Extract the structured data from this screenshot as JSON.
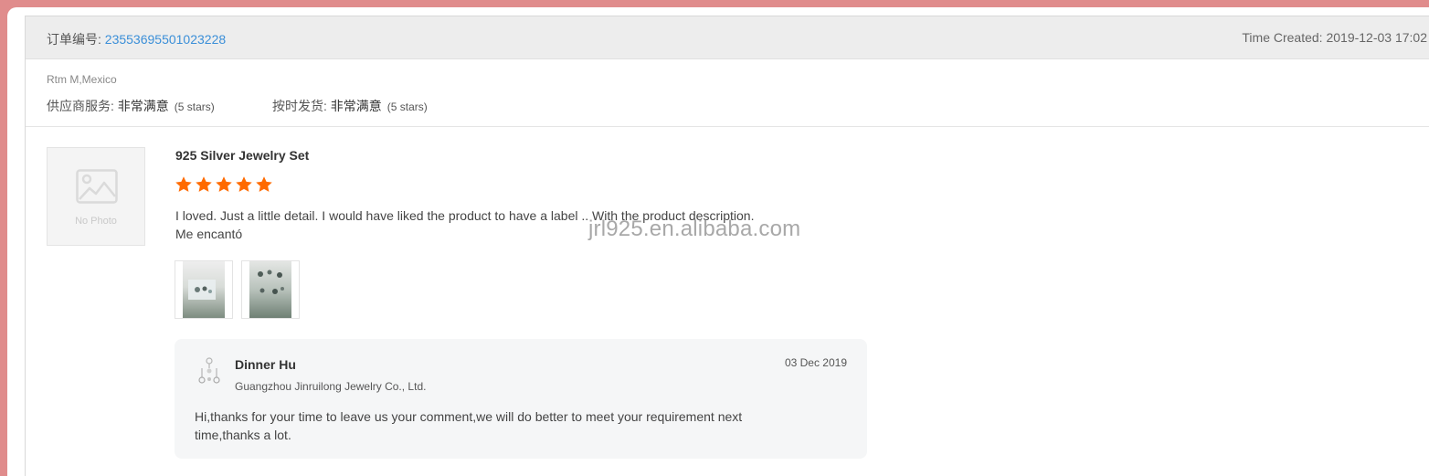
{
  "header": {
    "order_label": "订单编号: ",
    "order_number": "23553695501023228",
    "time_created": "Time Created: 2019-12-03 17:02"
  },
  "buyer": {
    "location": "Rtm M,Mexico",
    "ratings": [
      {
        "label": "供应商服务: ",
        "value": "非常满意",
        "stars_text": "(5 stars)"
      },
      {
        "label": "按时发货: ",
        "value": "非常满意",
        "stars_text": "(5 stars)"
      }
    ]
  },
  "product": {
    "no_photo_text": "No Photo",
    "title": "925 Silver Jewelry Set",
    "rating": 5,
    "star_color": "#ff6a00",
    "review_line1": "I loved.  Just a little detail.  I would have liked the product to have a label .. With the product description.",
    "review_line2": "Me encantó",
    "thumbnails": [
      "review-photo-1",
      "review-photo-2"
    ]
  },
  "watermark": "jrl925.en.alibaba.com",
  "reply": {
    "name": "Dinner Hu",
    "company": "Guangzhou Jinruilong Jewelry Co., Ltd.",
    "date": "03 Dec 2019",
    "text": "Hi,thanks for your time to leave us your comment,we will do better to meet your requirement next time,thanks a lot."
  },
  "colors": {
    "accent_link": "#3b8fd8",
    "frame_border": "#e08c8c",
    "header_bg": "#ededed",
    "reply_bg": "#f5f6f7"
  }
}
